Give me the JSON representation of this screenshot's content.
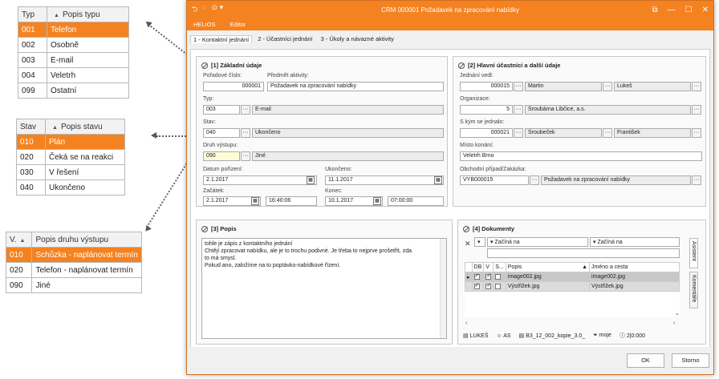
{
  "typ_table": {
    "headers": [
      "Typ",
      "Popis typu"
    ],
    "rows": [
      {
        "code": "001",
        "desc": "Telefon",
        "selected": true
      },
      {
        "code": "002",
        "desc": "Osobně"
      },
      {
        "code": "003",
        "desc": "E-mail"
      },
      {
        "code": "004",
        "desc": "Veletrh"
      },
      {
        "code": "099",
        "desc": "Ostatní"
      }
    ]
  },
  "stav_table": {
    "headers": [
      "Stav",
      "Popis stavu"
    ],
    "rows": [
      {
        "code": "010",
        "desc": "Plán",
        "selected": true
      },
      {
        "code": "020",
        "desc": "Čeká se na reakci"
      },
      {
        "code": "030",
        "desc": "V řešení"
      },
      {
        "code": "040",
        "desc": "Ukončeno"
      }
    ]
  },
  "vystup_table": {
    "headers": [
      "V.",
      "Popis druhu výstupu"
    ],
    "rows": [
      {
        "code": "010",
        "desc": "Schůzka - naplánovat termín",
        "selected": true
      },
      {
        "code": "020",
        "desc": "Telefon - naplánovat termín"
      },
      {
        "code": "090",
        "desc": "Jiné"
      }
    ]
  },
  "window": {
    "title": "CRM 000001 Požadavek na zpracování nabídky",
    "menu": [
      "HELIOS",
      "Editor"
    ],
    "accent": "#f58220",
    "tabs": [
      "1 - Kontaktní jednání",
      "2 - Účastníci jednání",
      "3 - Úkoly a návazné aktivity"
    ],
    "ok_label": "OK",
    "cancel_label": "Storno"
  },
  "zakladni": {
    "title": "[1] Základní údaje",
    "poradove_cislo_label": "Pořadové číslo:",
    "poradove_cislo": "000001",
    "predmet_label": "Předmět aktivity:",
    "predmet": "Požadavek na zpracování nabídky",
    "typ_label": "Typ:",
    "typ_code": "003",
    "typ_desc": "E-mail",
    "stav_label": "Stav:",
    "stav_code": "040",
    "stav_desc": "Ukončeno",
    "druh_label": "Druh výstupu:",
    "druh_code": "090",
    "druh_desc": "Jiné",
    "datum_porizeni_label": "Datum pořízení:",
    "datum_porizeni": "2.1.2017",
    "ukonceno_label": "Ukončeno:",
    "ukonceno": "11.1.2017",
    "zacatek_label": "Začátek:",
    "zacatek_datum": "2.1.2017",
    "zacatek_cas": "16:40:06",
    "konec_label": "Konec:",
    "konec_datum": "10.1.2017",
    "konec_cas": "07:00:00"
  },
  "ucastnici": {
    "title": "[2] Hlavní účastníci a další údaje",
    "jednani_vedl_label": "Jednání vedl:",
    "jednani_vedl_code": "000015",
    "jednani_vedl_jmeno": "Martin",
    "jednani_vedl_prijmeni": "Lukeš",
    "organizace_label": "Organizace:",
    "organizace_code": "5",
    "organizace_nazev": "Šroubárna Libčice, a.s.",
    "s_kym_label": "S kým se jednalo:",
    "s_kym_code": "000021",
    "s_kym_prijmeni": "Šroubeček",
    "s_kym_jmeno": "František",
    "misto_label": "Místo konání:",
    "misto": "Veletrh Brno",
    "obchodni_label": "Obchodní případ/Zakázka:",
    "obchodni_code": "VYB000015",
    "obchodni_nazev": "Požadavek na zpracování nabídky"
  },
  "popis": {
    "title": "[3] Popis",
    "lines": [
      "tohle je zápis z kontaktního jednání",
      "Chtějí zpracovat nabídku, ale je to trochu podivné. Je třeba to nejprve prošetřit, zda",
      "to má smysl.",
      "Pokud ano, založíme na to poptávko-nabídkové řízení."
    ]
  },
  "dokumenty": {
    "title": "[4] Dokumenty",
    "filter_left": "Začíná na",
    "filter_right": "Začíná na",
    "columns": [
      "DB",
      "V",
      "S...",
      "Popis",
      "Jméno a cesta"
    ],
    "rows": [
      {
        "popis": "image002.jpg",
        "jmeno": "image002.jpg"
      },
      {
        "popis": "Výstřižek.jpg",
        "jmeno": "Výstřižek.jpg"
      }
    ],
    "side_tabs": [
      "Asistent",
      "Komentáře"
    ],
    "status": [
      "LUKEŠ",
      "AS",
      "B3_12_002_kopie_3.0_",
      "moje",
      "2|0:000"
    ]
  }
}
